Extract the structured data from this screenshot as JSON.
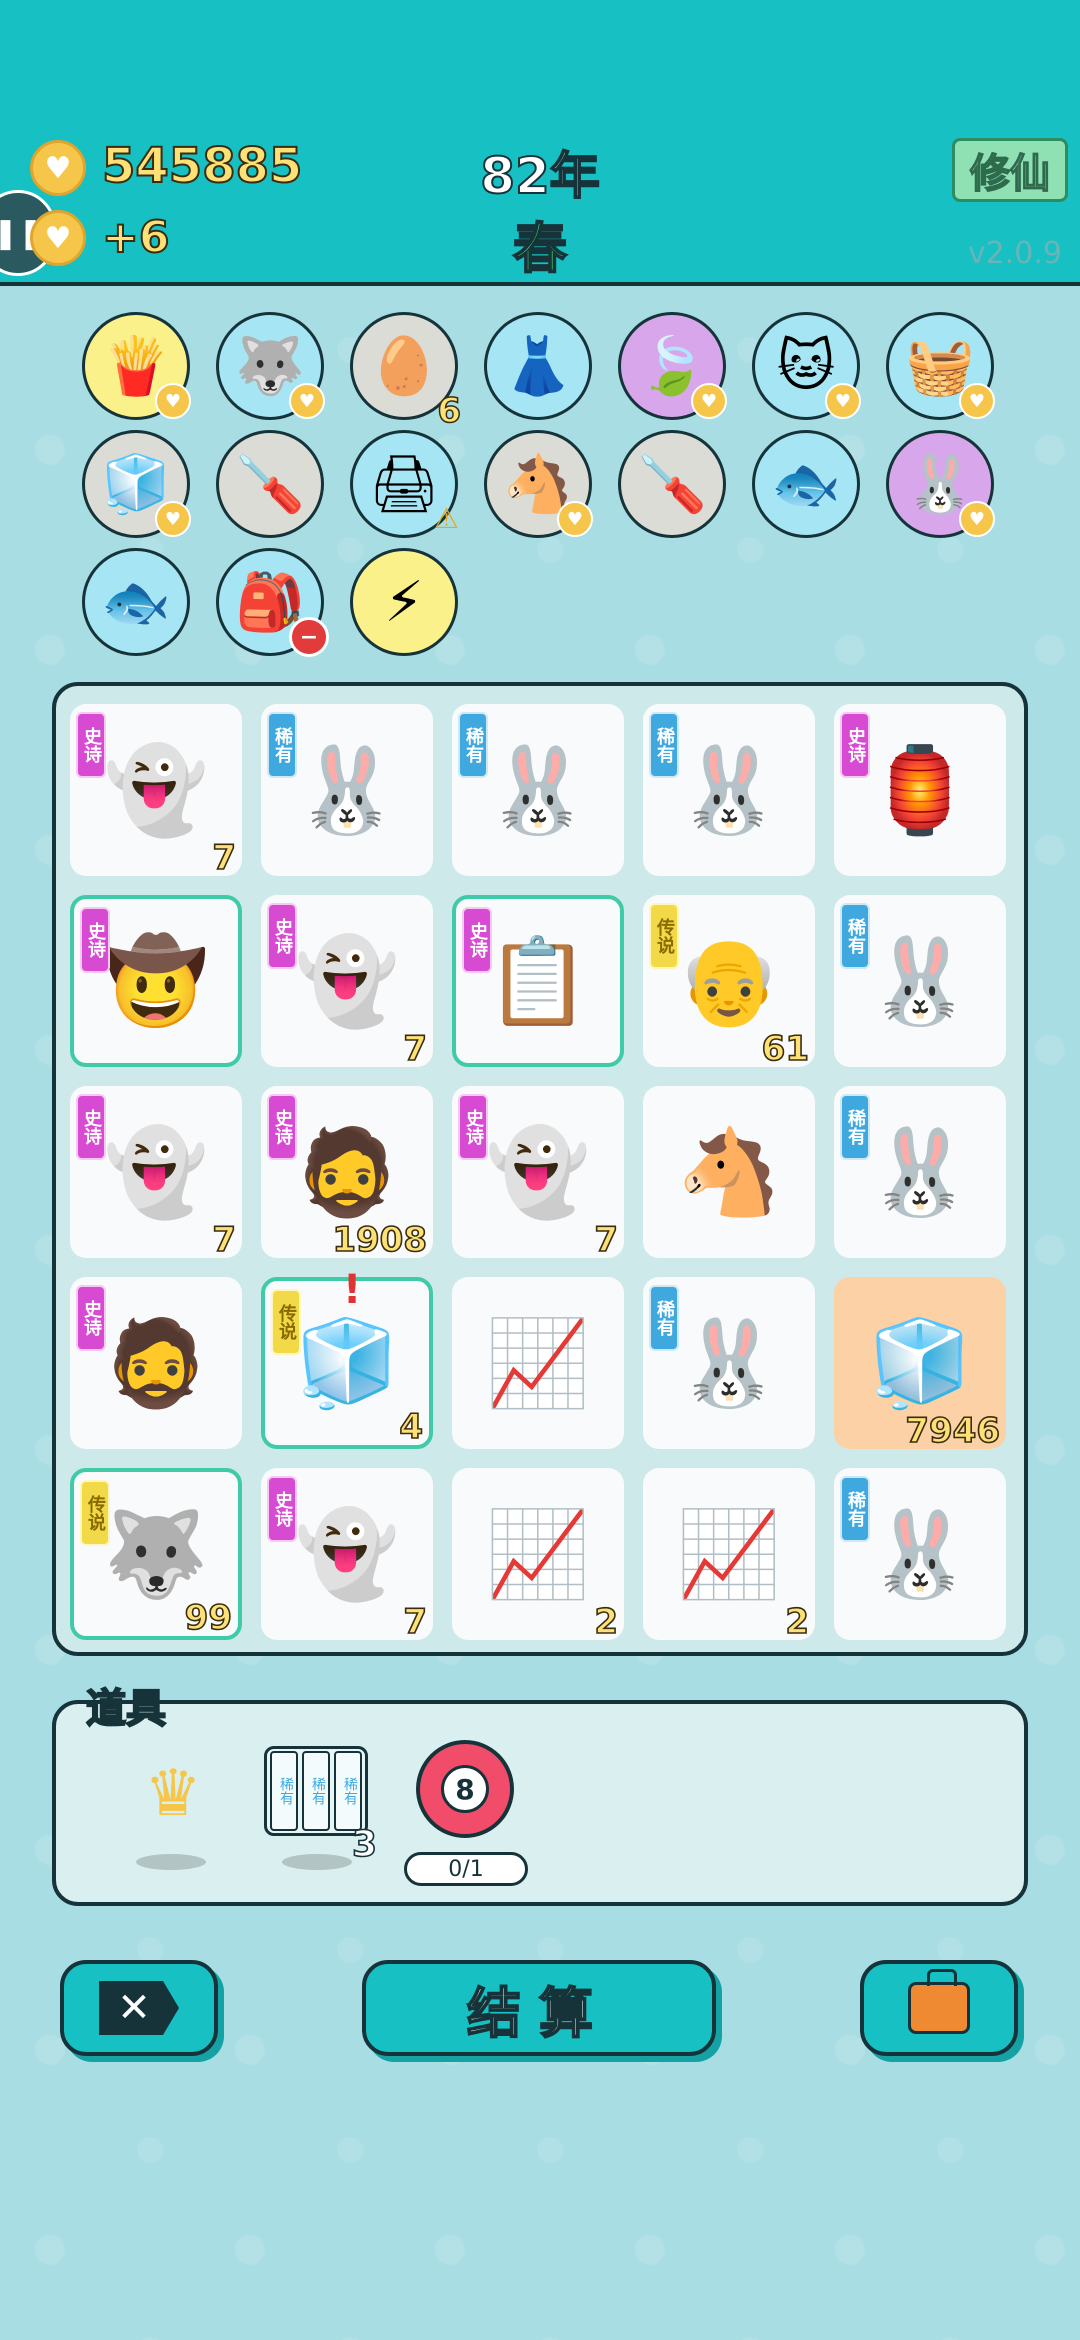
{
  "header": {
    "coins": "545885",
    "coin_rate": "+6",
    "year": "82年",
    "season": "春",
    "cultivate_label": "修仙",
    "version": "v2.0.9"
  },
  "owned_items": [
    {
      "name": "french-fries",
      "icon": "🍟",
      "color": "yellow",
      "badge": true
    },
    {
      "name": "husky",
      "icon": "🐺",
      "color": "blue",
      "badge": true
    },
    {
      "name": "egg-tray",
      "icon": "🥚",
      "color": "gray",
      "count": "6"
    },
    {
      "name": "pleated-skirt",
      "icon": "👗",
      "color": "blue"
    },
    {
      "name": "leaf",
      "icon": "🍃",
      "color": "purple",
      "badge": true
    },
    {
      "name": "cat",
      "icon": "🐱",
      "color": "blue",
      "badge": true
    },
    {
      "name": "fruit-basket",
      "icon": "🧺",
      "color": "blue",
      "badge": true
    },
    {
      "name": "sugar-cubes",
      "icon": "🧊",
      "color": "gray",
      "badge": true
    },
    {
      "name": "screwdriver",
      "icon": "🪛",
      "color": "gray"
    },
    {
      "name": "printer",
      "icon": "🖨",
      "color": "blue",
      "warn": true
    },
    {
      "name": "horse-couple",
      "icon": "🐴",
      "color": "gray",
      "badge": true
    },
    {
      "name": "screwdriver",
      "icon": "🪛",
      "color": "gray"
    },
    {
      "name": "fish-bowl",
      "icon": "🐟",
      "color": "blue"
    },
    {
      "name": "rabbit",
      "icon": "🐰",
      "color": "purple",
      "badge": true
    },
    {
      "name": "fish-bowl",
      "icon": "🐟",
      "color": "blue"
    },
    {
      "name": "rice-bag",
      "icon": "🎒",
      "color": "blue",
      "minus": true
    },
    {
      "name": "lightning",
      "icon": "⚡",
      "color": "yellow"
    }
  ],
  "rarity_labels": {
    "epic": "史诗",
    "rare": "稀有",
    "legend": "传说"
  },
  "board": [
    [
      {
        "name": "ghost",
        "icon": "👻",
        "tag": "epic",
        "num": "7"
      },
      {
        "name": "rabbit",
        "icon": "🐰",
        "tag": "rare"
      },
      {
        "name": "rabbit",
        "icon": "🐰",
        "tag": "rare"
      },
      {
        "name": "rabbit",
        "icon": "🐰",
        "tag": "rare"
      },
      {
        "name": "rabbit-house",
        "icon": "🏮",
        "tag": "epic"
      }
    ],
    [
      {
        "name": "cowboy-grandpa",
        "icon": "🤠",
        "tag": "epic",
        "sel": true
      },
      {
        "name": "ghost",
        "icon": "👻",
        "tag": "epic",
        "num": "7"
      },
      {
        "name": "ctrl-c-ctrl-v",
        "icon": "📋",
        "tag": "epic",
        "sel": true
      },
      {
        "name": "bald-man-glasses",
        "icon": "👴",
        "tag": "legend",
        "num": "61"
      },
      {
        "name": "rabbit",
        "icon": "🐰",
        "tag": "rare"
      }
    ],
    [
      {
        "name": "ghost",
        "icon": "👻",
        "tag": "epic",
        "num": "7"
      },
      {
        "name": "bearded-man",
        "icon": "🧔",
        "tag": "epic",
        "num": "1908"
      },
      {
        "name": "ghost",
        "icon": "👻",
        "tag": "epic",
        "num": "7"
      },
      {
        "name": "horse",
        "icon": "🐴"
      },
      {
        "name": "rabbit",
        "icon": "🐰",
        "tag": "rare"
      }
    ],
    [
      {
        "name": "bearded-man",
        "icon": "🧔",
        "tag": "epic"
      },
      {
        "name": "fridge",
        "icon": "🧊",
        "tag": "legend",
        "num": "4",
        "sel": true,
        "alert": "!"
      },
      {
        "name": "stock-chart",
        "icon": "📈"
      },
      {
        "name": "rabbit",
        "icon": "🐰",
        "tag": "rare"
      },
      {
        "name": "fridge",
        "icon": "🧊",
        "num": "7946",
        "orange": true
      }
    ],
    [
      {
        "name": "crowned-husky",
        "icon": "🐺",
        "tag": "legend",
        "num": "99",
        "sel": true
      },
      {
        "name": "ghost",
        "icon": "👻",
        "tag": "epic",
        "num": "7"
      },
      {
        "name": "stock-chart",
        "icon": "📈",
        "num": "2"
      },
      {
        "name": "stock-chart",
        "icon": "📈",
        "num": "2"
      },
      {
        "name": "rabbit",
        "icon": "🐰",
        "tag": "rare"
      }
    ]
  ],
  "props": {
    "title": "道具",
    "crown_icon": "♛",
    "rare_pack_label": "稀有",
    "rare_pack_count": "3",
    "ball_number": "8",
    "ball_progress": "0/1"
  },
  "buttons": {
    "quit_icon": "✕",
    "settle_label": "结算"
  }
}
